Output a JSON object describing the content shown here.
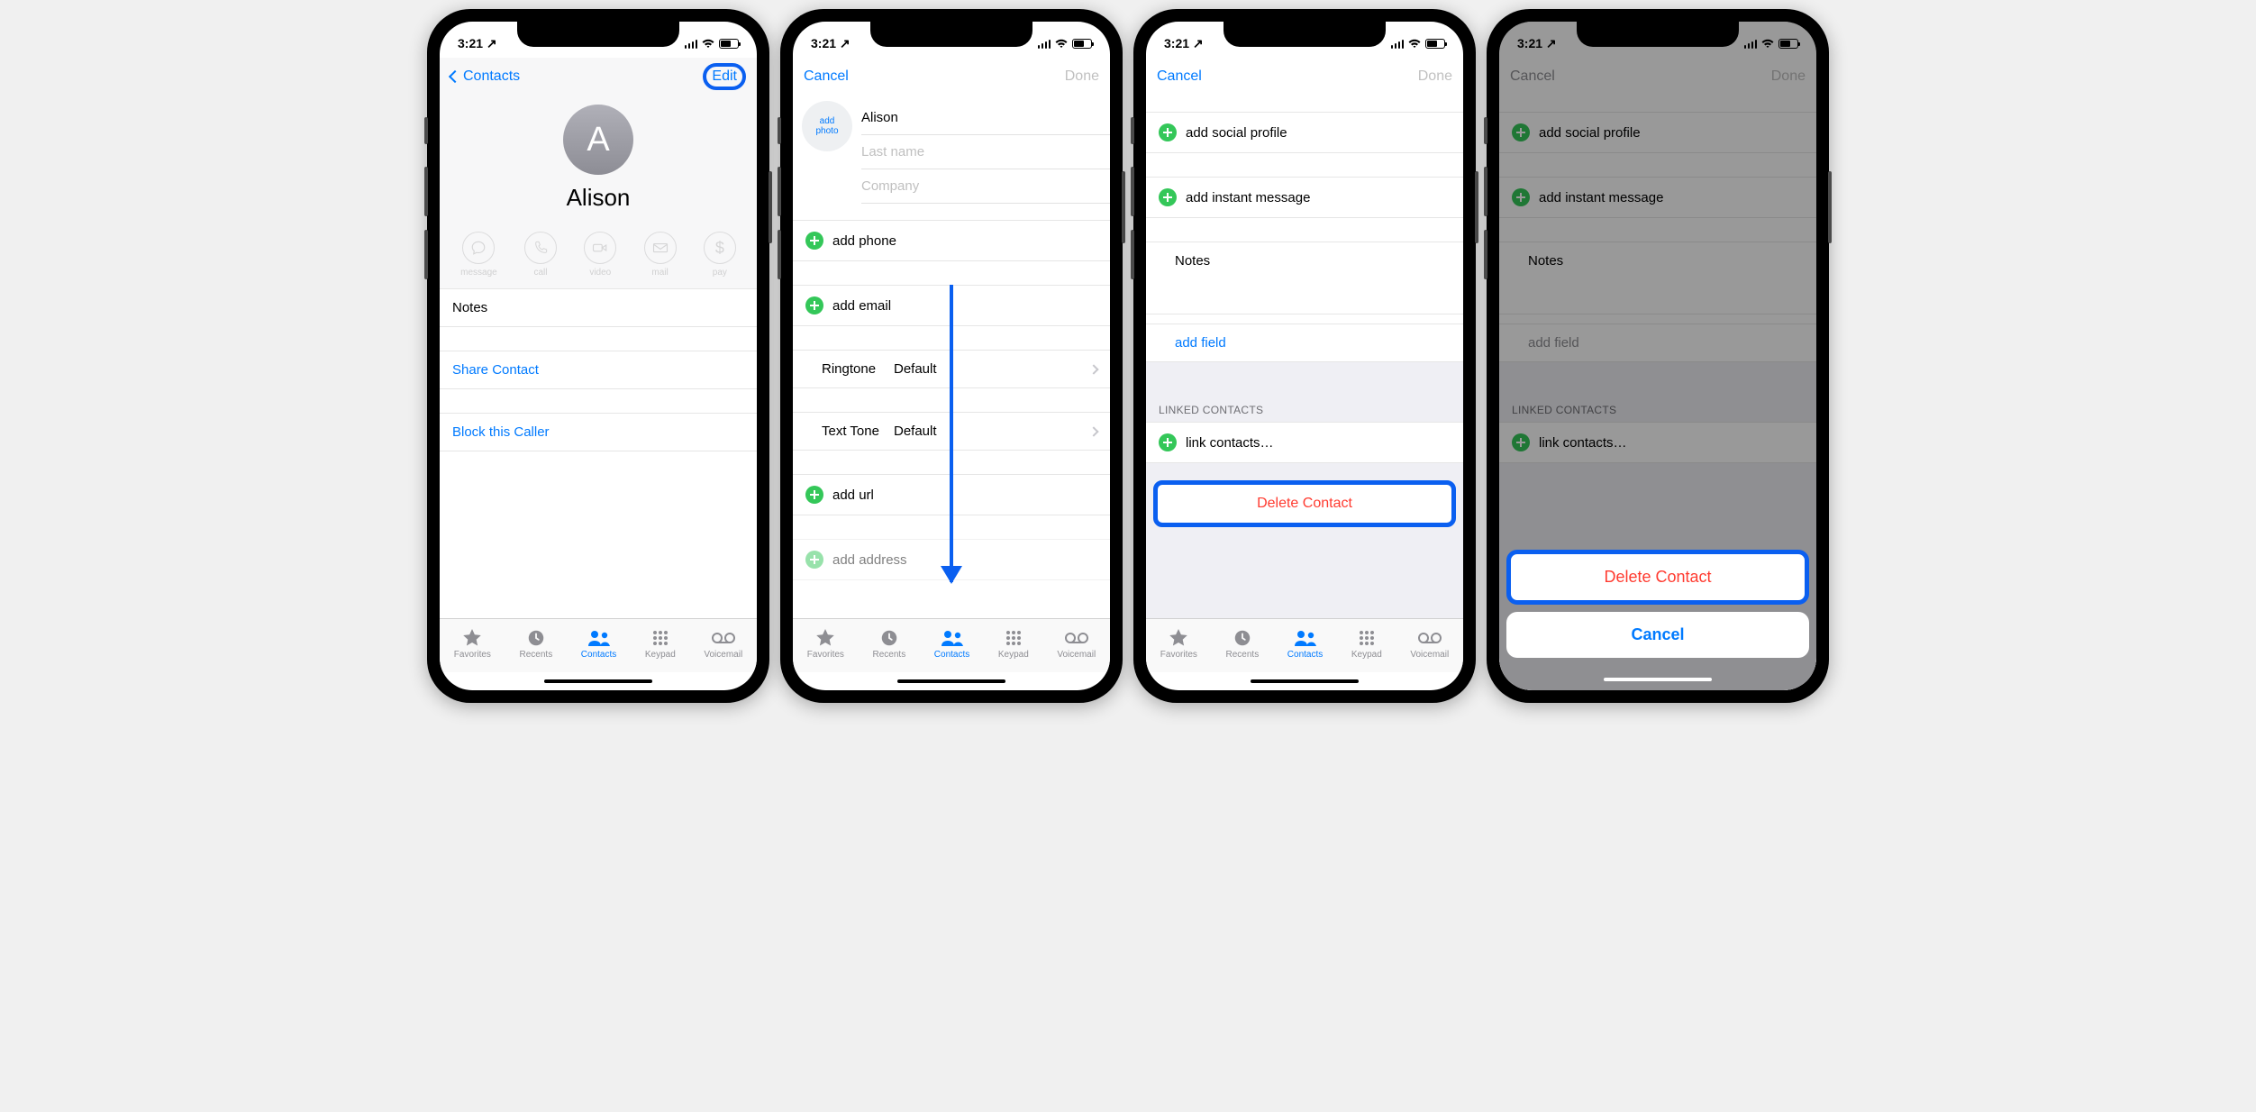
{
  "status": {
    "time": "3:21",
    "loc_arrow": "↗"
  },
  "colors": {
    "ios_blue": "#007aff",
    "ios_green": "#34c759",
    "ios_red": "#ff3b30",
    "annotate_blue": "#0a5ff0"
  },
  "screen1": {
    "back": "Contacts",
    "edit": "Edit",
    "initial": "A",
    "name": "Alison",
    "actions": [
      {
        "label": "message",
        "icon": "bubble"
      },
      {
        "label": "call",
        "icon": "phone"
      },
      {
        "label": "video",
        "icon": "camera"
      },
      {
        "label": "mail",
        "icon": "envelope"
      },
      {
        "label": "pay",
        "icon": "dollar"
      }
    ],
    "notes_label": "Notes",
    "share": "Share Contact",
    "block": "Block this Caller"
  },
  "screen2": {
    "cancel": "Cancel",
    "done": "Done",
    "add_photo_l1": "add",
    "add_photo_l2": "photo",
    "first_name": "Alison",
    "last_name_ph": "Last name",
    "company_ph": "Company",
    "add_phone": "add phone",
    "add_email": "add email",
    "ringtone_lbl": "Ringtone",
    "ringtone_val": "Default",
    "texttone_lbl": "Text Tone",
    "texttone_val": "Default",
    "add_url": "add url",
    "add_address": "add address"
  },
  "screen3": {
    "cancel": "Cancel",
    "done": "Done",
    "add_social": "add social profile",
    "add_im": "add instant message",
    "notes_lbl": "Notes",
    "add_field": "add field",
    "linked_hdr": "LINKED CONTACTS",
    "link_contacts": "link contacts…",
    "delete": "Delete Contact"
  },
  "screen4": {
    "cancel_nav": "Cancel",
    "done": "Done",
    "add_social": "add social profile",
    "add_im": "add instant message",
    "notes_lbl": "Notes",
    "add_field": "add field",
    "linked_hdr": "LINKED CONTACTS",
    "link_contacts": "link contacts…",
    "as_delete": "Delete Contact",
    "as_cancel": "Cancel"
  },
  "tabbar": {
    "items": [
      {
        "label": "Favorites"
      },
      {
        "label": "Recents"
      },
      {
        "label": "Contacts"
      },
      {
        "label": "Keypad"
      },
      {
        "label": "Voicemail"
      }
    ]
  }
}
